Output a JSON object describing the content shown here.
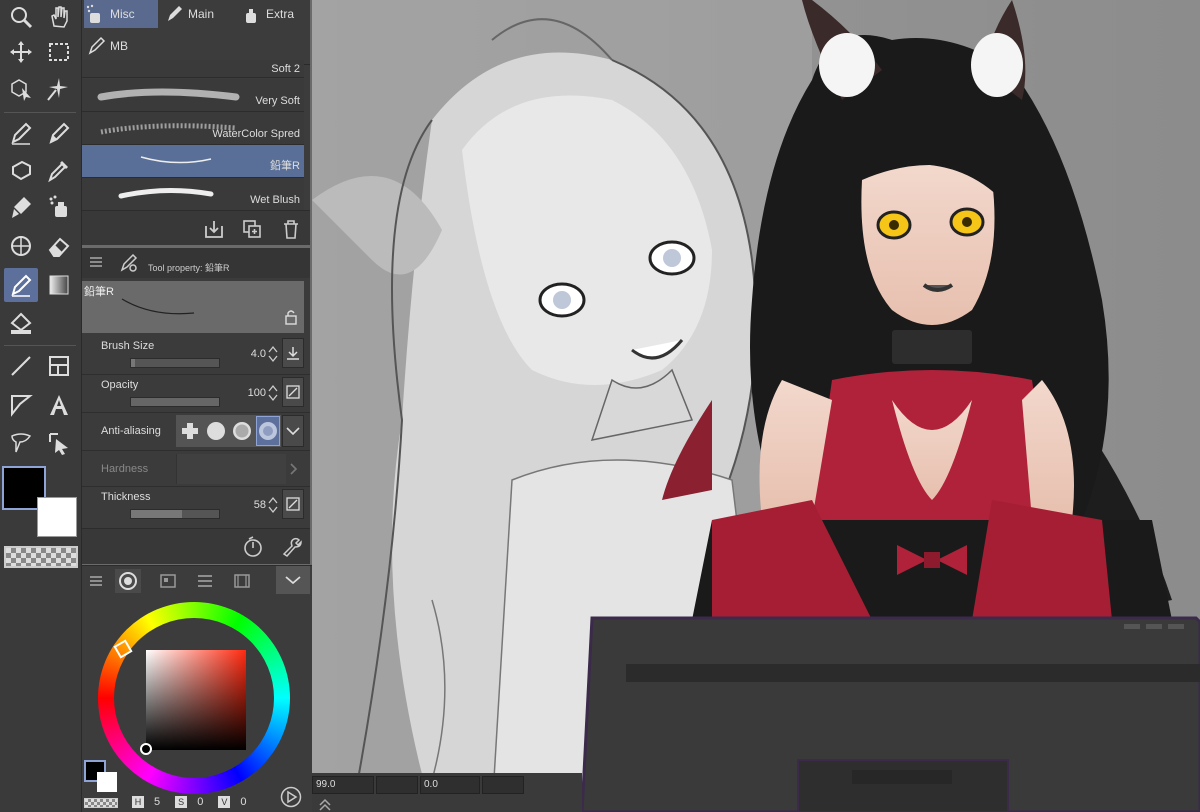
{
  "brush_tabs": [
    {
      "label": "Misc",
      "selected": true
    },
    {
      "label": "Main",
      "selected": false
    },
    {
      "label": "Extra",
      "selected": false
    },
    {
      "label": "MB",
      "selected": false
    }
  ],
  "brushes": [
    {
      "name": "Soft 2",
      "selected": false
    },
    {
      "name": "Very Soft",
      "selected": false
    },
    {
      "name": "WaterColor Spred",
      "selected": false
    },
    {
      "name": "鉛筆R",
      "selected": true
    },
    {
      "name": "Wet Blush",
      "selected": false
    }
  ],
  "tool_property": {
    "title": "Tool property: 鉛筆R",
    "preview_name": "鉛筆R",
    "brush_size": {
      "label": "Brush Size",
      "value": "4.0",
      "fill": 0.04
    },
    "opacity": {
      "label": "Opacity",
      "value": "100",
      "fill": 1.0
    },
    "anti_aliasing": {
      "label": "Anti-aliasing",
      "selected_index": 3
    },
    "hardness": {
      "label": "Hardness"
    },
    "thickness": {
      "label": "Thickness",
      "value": "58",
      "fill": 0.58
    }
  },
  "colors": {
    "main": "#000000",
    "sub": "#ffffff",
    "accent": "#5d6f9b"
  },
  "color_values": {
    "h_label": "H",
    "h": "5",
    "s_label": "S",
    "s": "0",
    "v_label": "V",
    "v": "0"
  },
  "statusbar": {
    "zoom": "99.0",
    "rotation": "0.0"
  }
}
